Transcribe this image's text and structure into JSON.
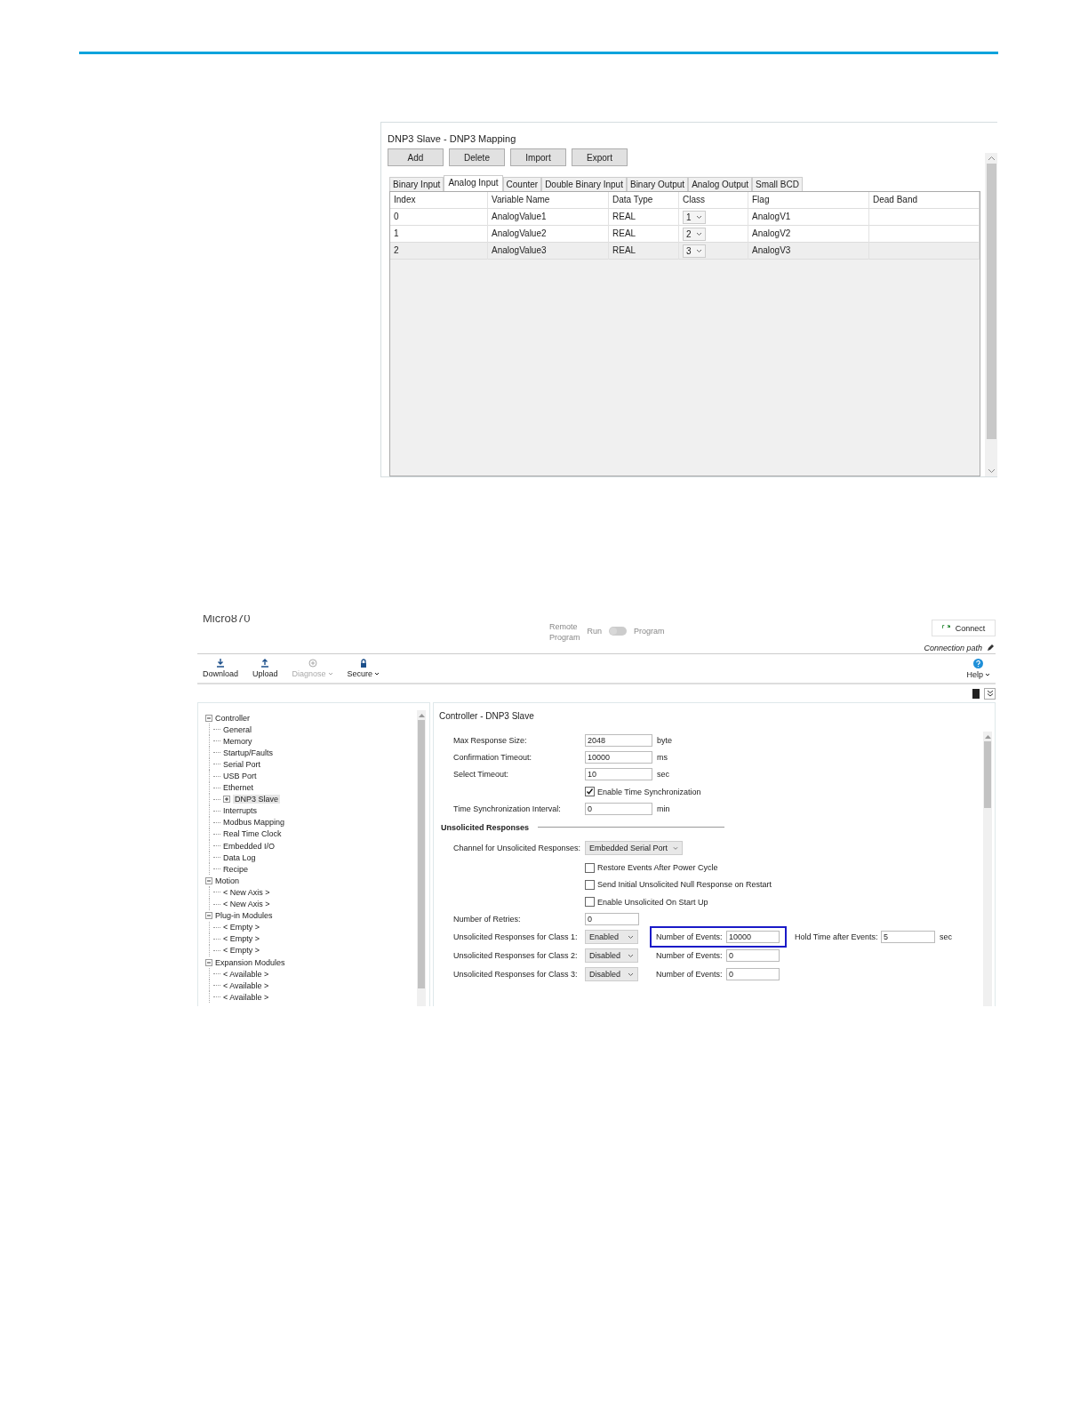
{
  "mapping_window": {
    "title": "DNP3 Slave - DNP3 Mapping",
    "buttons": [
      "Add",
      "Delete",
      "Import",
      "Export"
    ],
    "tabs": [
      {
        "label": "Binary Input",
        "selected": false
      },
      {
        "label": "Analog Input",
        "selected": true
      },
      {
        "label": "Counter",
        "selected": false
      },
      {
        "label": "Double Binary Input",
        "selected": false
      },
      {
        "label": "Binary Output",
        "selected": false
      },
      {
        "label": "Analog Output",
        "selected": false
      },
      {
        "label": "Small BCD",
        "selected": false
      }
    ],
    "table": {
      "columns": [
        "Index",
        "Variable Name",
        "Data Type",
        "Class",
        "Flag",
        "Dead Band"
      ],
      "rows": [
        {
          "index": "0",
          "variable_name": "AnalogValue1",
          "data_type": "REAL",
          "class": "1",
          "flag": "AnalogV1",
          "selected": false
        },
        {
          "index": "1",
          "variable_name": "AnalogValue2",
          "data_type": "REAL",
          "class": "2",
          "flag": "AnalogV2",
          "selected": false
        },
        {
          "index": "2",
          "variable_name": "AnalogValue3",
          "data_type": "REAL",
          "class": "3",
          "flag": "AnalogV3",
          "selected": true
        }
      ]
    }
  },
  "controller_window": {
    "product": "Micro870",
    "mode": {
      "remote_lines": [
        "Remote",
        "Program"
      ],
      "run_label": "Run",
      "program_label": "Program",
      "on": false
    },
    "connect": "Connect",
    "connection_path": "Connection path",
    "toolbar": [
      {
        "kind": "download",
        "label": "Download",
        "disabled": false,
        "dropdown": false
      },
      {
        "kind": "upload",
        "label": "Upload",
        "disabled": false,
        "dropdown": false
      },
      {
        "kind": "diagnose",
        "label": "Diagnose",
        "disabled": true,
        "dropdown": true
      },
      {
        "kind": "secure",
        "label": "Secure",
        "disabled": false,
        "dropdown": true
      }
    ],
    "help": {
      "label": "Help",
      "dropdown": true
    },
    "tree": [
      {
        "label": "Controller",
        "expanded": true,
        "children": [
          {
            "label": "General",
            "selected": false
          },
          {
            "label": "Memory",
            "selected": false
          },
          {
            "label": "Startup/Faults",
            "selected": false
          },
          {
            "label": "Serial Port",
            "selected": false
          },
          {
            "label": "USB Port",
            "selected": false
          },
          {
            "label": "Ethernet",
            "selected": false
          },
          {
            "label": "DNP3 Slave",
            "selected": true,
            "expanded": false
          },
          {
            "label": "Interrupts",
            "selected": false
          },
          {
            "label": "Modbus Mapping",
            "selected": false
          },
          {
            "label": "Real Time Clock",
            "selected": false
          },
          {
            "label": "Embedded I/O",
            "selected": false
          },
          {
            "label": "Data Log",
            "selected": false
          },
          {
            "label": "Recipe",
            "selected": false
          }
        ]
      },
      {
        "label": "Motion",
        "expanded": true,
        "children": [
          {
            "label": "< New Axis >",
            "selected": false
          },
          {
            "label": "< New Axis >",
            "selected": false
          }
        ]
      },
      {
        "label": "Plug-in Modules",
        "expanded": true,
        "children": [
          {
            "label": "< Empty >",
            "selected": false
          },
          {
            "label": "< Empty >",
            "selected": false
          },
          {
            "label": "< Empty >",
            "selected": false
          }
        ]
      },
      {
        "label": "Expansion Modules",
        "expanded": true,
        "children": [
          {
            "label": "< Available >",
            "selected": false
          },
          {
            "label": "< Available >",
            "selected": false
          },
          {
            "label": "< Available >",
            "selected": false
          }
        ]
      }
    ],
    "settings": {
      "title": "Controller - DNP3 Slave",
      "rows": [
        {
          "kind": "text",
          "label": "Max Response Size:",
          "value": "2048",
          "unit": "byte"
        },
        {
          "kind": "text",
          "label": "Confirmation Timeout:",
          "value": "10000",
          "unit": "ms"
        },
        {
          "kind": "text",
          "label": "Select Timeout:",
          "value": "10",
          "unit": "sec"
        },
        {
          "kind": "checkbox",
          "label": "Enable Time Synchronization",
          "checked": true
        },
        {
          "kind": "text",
          "label": "Time Synchronization Interval:",
          "value": "0",
          "unit": "min"
        },
        {
          "kind": "section",
          "label": "Unsolicited Responses"
        },
        {
          "kind": "select",
          "label": "Channel for Unsolicited Responses:",
          "value": "Embedded Serial Port"
        },
        {
          "kind": "checkbox",
          "label": "Restore Events After Power Cycle",
          "checked": false
        },
        {
          "kind": "checkbox",
          "label": "Send Initial Unsolicited Null Response on Restart",
          "checked": false
        },
        {
          "kind": "checkbox",
          "label": "Enable Unsolicited On Start Up",
          "checked": false
        },
        {
          "kind": "number",
          "label": "Number of Retries:",
          "value": "0"
        },
        {
          "kind": "class",
          "label": "Unsolicited Responses for Class 1:",
          "value": "Enabled",
          "events_label": "Number of Events:",
          "events_value": "10000",
          "highlighted": true,
          "hold_label": "Hold Time after Events:",
          "hold_value": "5",
          "hold_unit": "sec"
        },
        {
          "kind": "class",
          "label": "Unsolicited Responses for Class 2:",
          "value": "Disabled",
          "events_label": "Number of Events:",
          "events_value": "0",
          "highlighted": false
        },
        {
          "kind": "class",
          "label": "Unsolicited Responses for Class 3:",
          "value": "Disabled",
          "events_label": "Number of Events:",
          "events_value": "0",
          "highlighted": false
        }
      ]
    }
  }
}
